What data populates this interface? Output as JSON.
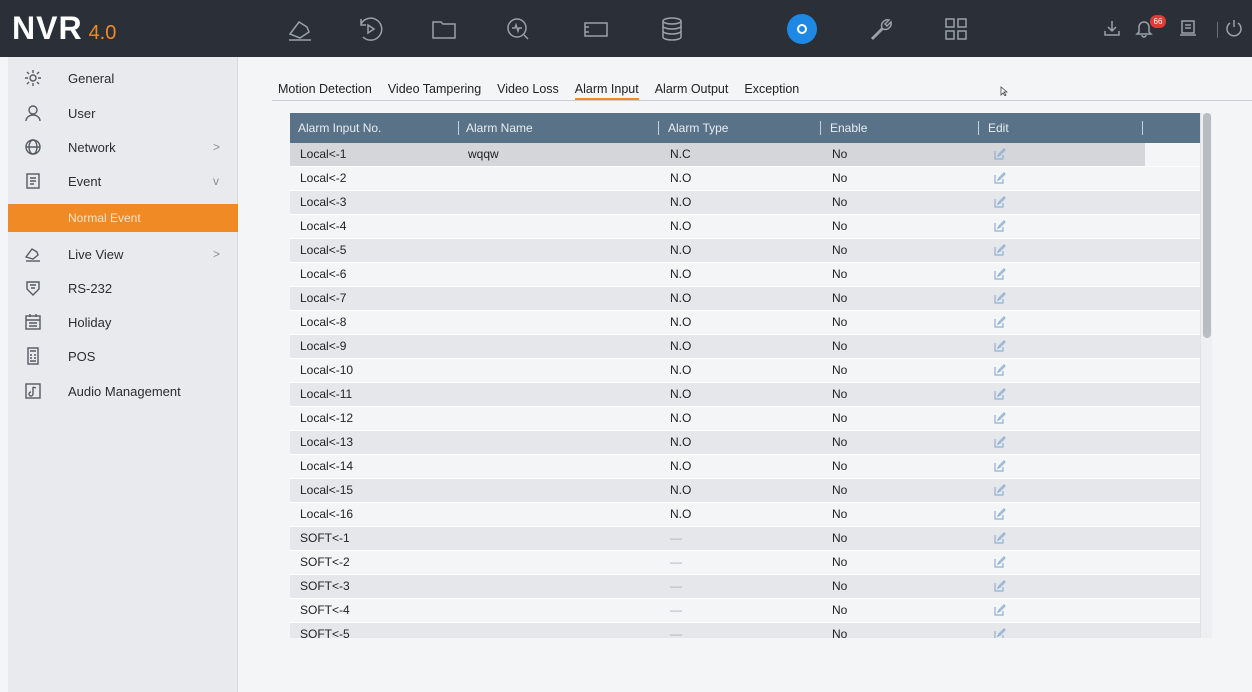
{
  "app": {
    "name": "NVR",
    "version": "4.0"
  },
  "topnav": [
    {
      "name": "live-view-icon"
    },
    {
      "name": "playback-icon"
    },
    {
      "name": "file-management-icon"
    },
    {
      "name": "smart-analysis-icon"
    },
    {
      "name": "camera-icon"
    },
    {
      "name": "storage-icon"
    },
    {
      "name": "configuration-icon",
      "active": true
    },
    {
      "name": "maintenance-icon"
    },
    {
      "name": "grid-icon"
    }
  ],
  "topright": {
    "notification_count": "66"
  },
  "sidebar": {
    "items": [
      {
        "label": "General"
      },
      {
        "label": "User"
      },
      {
        "label": "Network",
        "arrow": ">"
      },
      {
        "label": "Event",
        "arrow": "v"
      },
      {
        "label": "Live View",
        "arrow": ">"
      },
      {
        "label": "RS-232"
      },
      {
        "label": "Holiday"
      },
      {
        "label": "POS"
      },
      {
        "label": "Audio Management"
      }
    ],
    "sub_item": "Normal Event"
  },
  "tabs": [
    "Motion Detection",
    "Video Tampering",
    "Video Loss",
    "Alarm Input",
    "Alarm Output",
    "Exception"
  ],
  "active_tab": "Alarm Input",
  "table": {
    "columns": [
      "Alarm Input No.",
      "Alarm Name",
      "Alarm Type",
      "Enable",
      "Edit"
    ],
    "rows": [
      {
        "no": "Local<-1",
        "name": "wqqw",
        "type": "N.C",
        "enable": "No"
      },
      {
        "no": "Local<-2",
        "name": "",
        "type": "N.O",
        "enable": "No"
      },
      {
        "no": "Local<-3",
        "name": "",
        "type": "N.O",
        "enable": "No"
      },
      {
        "no": "Local<-4",
        "name": "",
        "type": "N.O",
        "enable": "No"
      },
      {
        "no": "Local<-5",
        "name": "",
        "type": "N.O",
        "enable": "No"
      },
      {
        "no": "Local<-6",
        "name": "",
        "type": "N.O",
        "enable": "No"
      },
      {
        "no": "Local<-7",
        "name": "",
        "type": "N.O",
        "enable": "No"
      },
      {
        "no": "Local<-8",
        "name": "",
        "type": "N.O",
        "enable": "No"
      },
      {
        "no": "Local<-9",
        "name": "",
        "type": "N.O",
        "enable": "No"
      },
      {
        "no": "Local<-10",
        "name": "",
        "type": "N.O",
        "enable": "No"
      },
      {
        "no": "Local<-11",
        "name": "",
        "type": "N.O",
        "enable": "No"
      },
      {
        "no": "Local<-12",
        "name": "",
        "type": "N.O",
        "enable": "No"
      },
      {
        "no": "Local<-13",
        "name": "",
        "type": "N.O",
        "enable": "No"
      },
      {
        "no": "Local<-14",
        "name": "",
        "type": "N.O",
        "enable": "No"
      },
      {
        "no": "Local<-15",
        "name": "",
        "type": "N.O",
        "enable": "No"
      },
      {
        "no": "Local<-16",
        "name": "",
        "type": "N.O",
        "enable": "No"
      },
      {
        "no": "SOFT<-1",
        "name": "",
        "type": "—",
        "enable": "No"
      },
      {
        "no": "SOFT<-2",
        "name": "",
        "type": "—",
        "enable": "No"
      },
      {
        "no": "SOFT<-3",
        "name": "",
        "type": "—",
        "enable": "No"
      },
      {
        "no": "SOFT<-4",
        "name": "",
        "type": "—",
        "enable": "No"
      },
      {
        "no": "SOFT<-5",
        "name": "",
        "type": "—",
        "enable": "No"
      }
    ]
  },
  "colors": {
    "accent": "#f08a24",
    "header_bar": "#2b3038",
    "table_header": "#5a7287",
    "active_icon": "#1e88e5"
  }
}
